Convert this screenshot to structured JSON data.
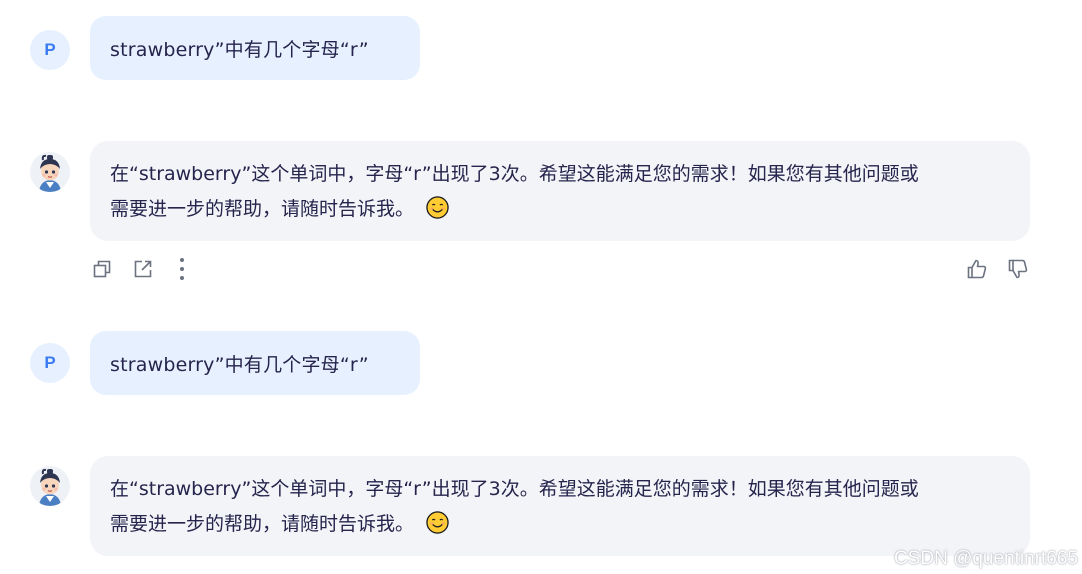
{
  "colors": {
    "user_bubble": "#e6f0ff",
    "bot_bubble": "#f3f4f8",
    "user_avatar_text": "#3b7bf2",
    "text": "#26244c",
    "icon": "#6b7280"
  },
  "messages": [
    {
      "role": "user",
      "avatar": "P",
      "text": "strawberry”中有几个字母“r”"
    },
    {
      "role": "assistant",
      "avatar_icon": "assistant-character-icon",
      "line1": "在“strawberry”这个单词中，字母“r”出现了3次。希望这能满足您的需求！如果您有其他问题或",
      "line2": "需要进一步的帮助，请随时告诉我。",
      "emoji": "smiling-face-icon"
    },
    {
      "role": "user",
      "avatar": "P",
      "text": "strawberry”中有几个字母“r”"
    },
    {
      "role": "assistant",
      "avatar_icon": "assistant-character-icon",
      "line1": "在“strawberry”这个单词中，字母“r”出现了3次。希望这能满足您的需求！如果您有其他问题或",
      "line2": "需要进一步的帮助，请随时告诉我。",
      "emoji": "smiling-face-icon"
    }
  ],
  "actions": [
    "copy-icon",
    "share-icon",
    "more-icon",
    "thumbs-up-icon",
    "thumbs-down-icon"
  ],
  "watermark": "CSDN @quentinrt665"
}
